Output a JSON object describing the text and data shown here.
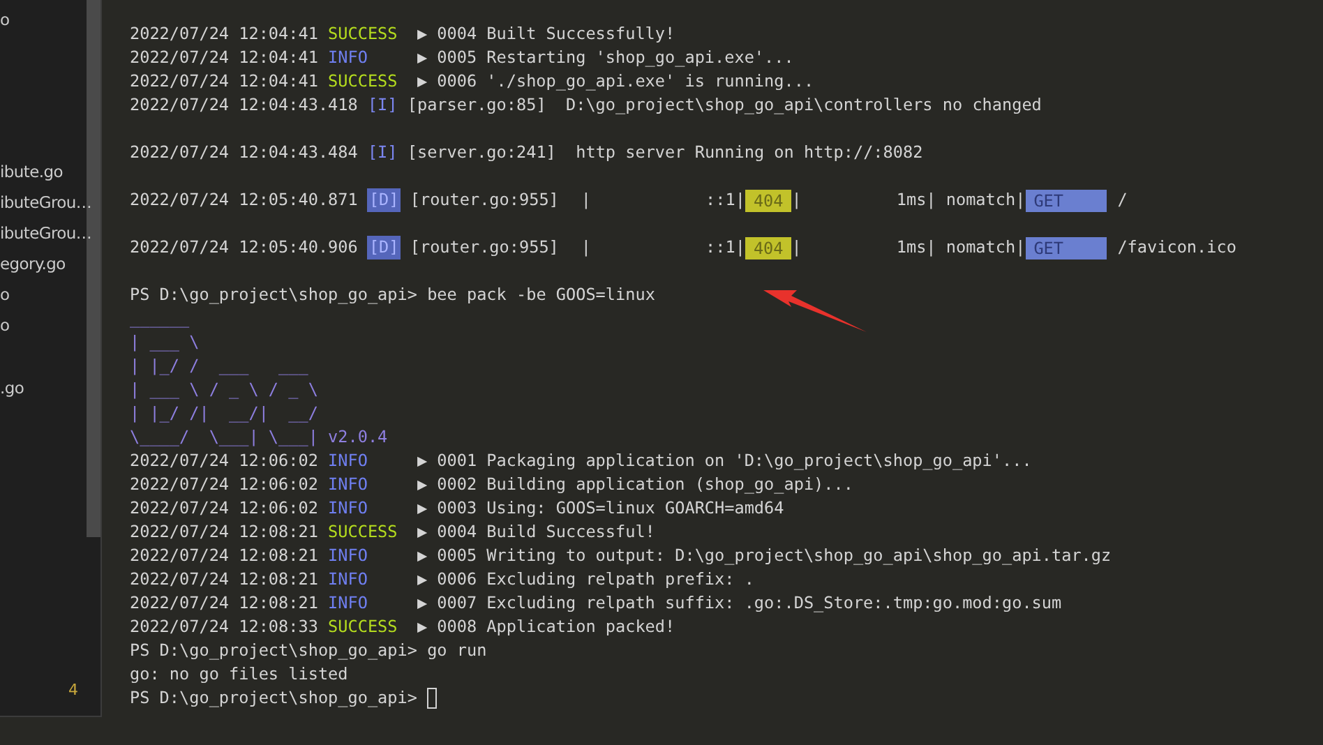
{
  "sidebar": {
    "groups": [
      [
        "o"
      ],
      [
        "ibute.go",
        "ibuteGrou…",
        "ibuteGrou…",
        "egory.go",
        "o",
        "o"
      ],
      [
        ".go"
      ]
    ],
    "badge": "4"
  },
  "terminal": {
    "lines": [
      {
        "kind": "log",
        "time": "2022/07/24 12:04:41",
        "level": "SUCCESS",
        "color": "#b4dc1e",
        "text": "▶ 0004 Built Successfully!"
      },
      {
        "kind": "log",
        "time": "2022/07/24 12:04:41",
        "level": "INFO",
        "color": "#6f7ff0",
        "text": "▶ 0005 Restarting 'shop_go_api.exe'..."
      },
      {
        "kind": "log",
        "time": "2022/07/24 12:04:41",
        "level": "SUCCESS",
        "color": "#b4dc1e",
        "text": "▶ 0006 './shop_go_api.exe' is running..."
      },
      {
        "kind": "beego",
        "time": "2022/07/24 12:04:43.418",
        "tag": "[I]",
        "tag_highlight": false,
        "source": "[parser.go:85]",
        "text": "D:\\go_project\\shop_go_api\\controllers no changed"
      },
      {
        "kind": "blank"
      },
      {
        "kind": "beego",
        "time": "2022/07/24 12:04:43.484",
        "tag": "[I]",
        "tag_highlight": false,
        "source": "[server.go:241]",
        "text": "http server Running on http://:8082"
      },
      {
        "kind": "blank"
      },
      {
        "kind": "request",
        "time": "2022/07/24 12:05:40.871",
        "tag": "[D]",
        "tag_highlight": true,
        "segments": [
          {
            "kind": "source",
            "text": "[router.go:955]"
          },
          {
            "kind": "pipe",
            "text": "|"
          },
          {
            "kind": "ip",
            "text": "::1|"
          },
          {
            "kind": "status",
            "text": "404"
          },
          {
            "kind": "pipe2",
            "text": "|"
          },
          {
            "kind": "latency",
            "text": "1ms|"
          },
          {
            "kind": "match",
            "text": "nomatch|"
          },
          {
            "kind": "method",
            "text": "GET"
          },
          {
            "kind": "path",
            "text": "/"
          }
        ]
      },
      {
        "kind": "blank"
      },
      {
        "kind": "request",
        "time": "2022/07/24 12:05:40.906",
        "tag": "[D]",
        "tag_highlight": true,
        "segments": [
          {
            "kind": "source",
            "text": "[router.go:955]"
          },
          {
            "kind": "pipe",
            "text": "|"
          },
          {
            "kind": "ip",
            "text": "::1|"
          },
          {
            "kind": "status",
            "text": "404"
          },
          {
            "kind": "pipe2",
            "text": "|"
          },
          {
            "kind": "latency",
            "text": "1ms|"
          },
          {
            "kind": "match",
            "text": "nomatch|"
          },
          {
            "kind": "method",
            "text": "GET"
          },
          {
            "kind": "path",
            "text": "/favicon.ico"
          }
        ]
      },
      {
        "kind": "blank"
      },
      {
        "kind": "prompt",
        "prompt": "PS D:\\go_project\\shop_go_api>",
        "command": "bee pack -be GOOS=linux",
        "cursor": false
      },
      {
        "kind": "art",
        "lines": [
          "______",
          "| ___ \\",
          "| |_/ /  ___   ___",
          "| ___ \\ / _ \\ / _ \\",
          "| |_/ /|  __/|  __/",
          "\\____/  \\___| \\___|"
        ],
        "version": "v2.0.4"
      },
      {
        "kind": "log",
        "time": "2022/07/24 12:06:02",
        "level": "INFO",
        "color": "#6f7ff0",
        "text": "▶ 0001 Packaging application on 'D:\\go_project\\shop_go_api'..."
      },
      {
        "kind": "log",
        "time": "2022/07/24 12:06:02",
        "level": "INFO",
        "color": "#6f7ff0",
        "text": "▶ 0002 Building application (shop_go_api)..."
      },
      {
        "kind": "log",
        "time": "2022/07/24 12:06:02",
        "level": "INFO",
        "color": "#6f7ff0",
        "text": "▶ 0003 Using: GOOS=linux GOARCH=amd64"
      },
      {
        "kind": "log",
        "time": "2022/07/24 12:08:21",
        "level": "SUCCESS",
        "color": "#b4dc1e",
        "text": "▶ 0004 Build Successful!"
      },
      {
        "kind": "log",
        "time": "2022/07/24 12:08:21",
        "level": "INFO",
        "color": "#6f7ff0",
        "text": "▶ 0005 Writing to output: D:\\go_project\\shop_go_api\\shop_go_api.tar.gz"
      },
      {
        "kind": "log",
        "time": "2022/07/24 12:08:21",
        "level": "INFO",
        "color": "#6f7ff0",
        "text": "▶ 0006 Excluding relpath prefix: ."
      },
      {
        "kind": "log",
        "time": "2022/07/24 12:08:21",
        "level": "INFO",
        "color": "#6f7ff0",
        "text": "▶ 0007 Excluding relpath suffix: .go:.DS_Store:.tmp:go.mod:go.sum"
      },
      {
        "kind": "log",
        "time": "2022/07/24 12:08:33",
        "level": "SUCCESS",
        "color": "#b4dc1e",
        "text": "▶ 0008 Application packed!"
      },
      {
        "kind": "prompt",
        "prompt": "PS D:\\go_project\\shop_go_api>",
        "command": "go run",
        "cursor": false
      },
      {
        "kind": "plain",
        "text": "go: no go files listed"
      },
      {
        "kind": "prompt",
        "prompt": "PS D:\\go_project\\shop_go_api>",
        "cursor": true
      }
    ]
  }
}
